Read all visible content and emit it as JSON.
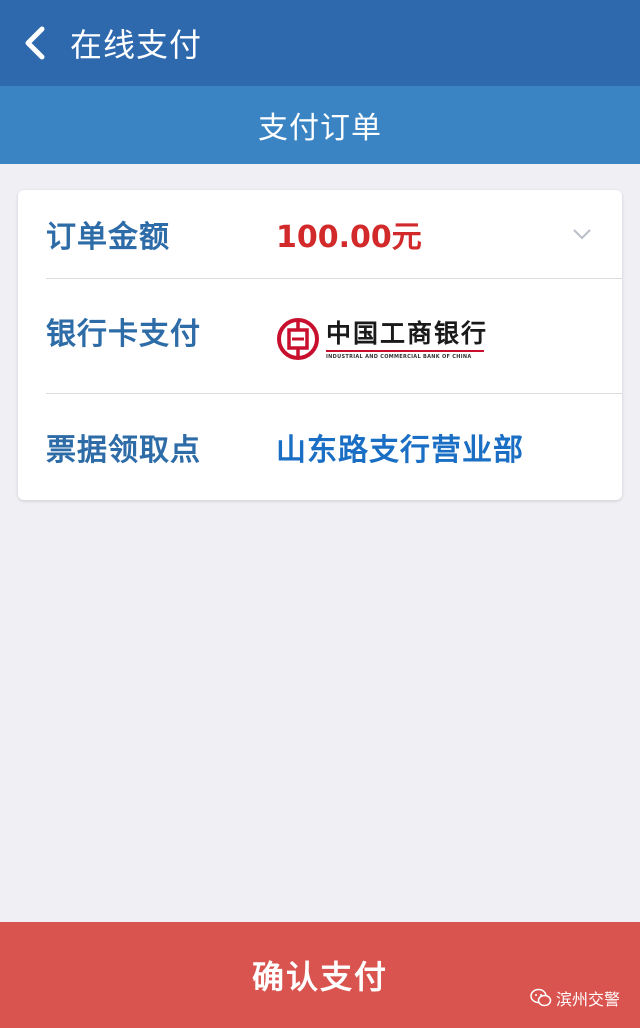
{
  "app_bar": {
    "title": "在线支付",
    "back_icon": "chevron-left-icon"
  },
  "sub_header": {
    "title": "支付订单"
  },
  "order_card": {
    "amount": {
      "label": "订单金额",
      "value": "100.00元",
      "expand_icon": "chevron-down-icon"
    },
    "payment": {
      "label": "银行卡支付",
      "bank_name": "中国工商银行",
      "bank_name_en": "INDUSTRIAL AND COMMERCIAL BANK OF CHINA",
      "bank_logo_icon": "icbc-logo-icon"
    },
    "pickup": {
      "label": "票据领取点",
      "value": "山东路支行营业部"
    }
  },
  "footer": {
    "confirm_label": "确认支付"
  },
  "watermark": {
    "text": "滨州交警",
    "icon": "wechat-icon"
  },
  "colors": {
    "app_bar": "#2f69ad",
    "sub_header": "#3a84c3",
    "label": "#2e6ca8",
    "amount": "#d22a2a",
    "branch": "#1a6fc4",
    "confirm": "#d9534f",
    "background": "#efeff4"
  }
}
